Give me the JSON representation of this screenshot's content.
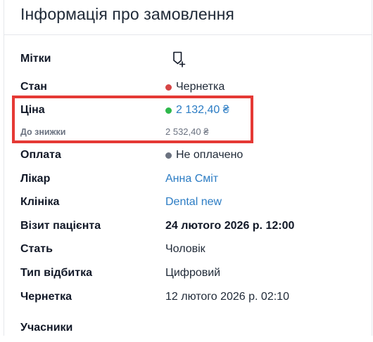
{
  "header": {
    "title": "Інформація про замовлення"
  },
  "rows": {
    "tags": {
      "label": "Мітки",
      "icon": "tag-add-icon"
    },
    "status": {
      "label": "Стан",
      "value": "Чернетка",
      "dot_color": "#d64545"
    },
    "price": {
      "label": "Ціна",
      "value": "2 132,40 ₴",
      "dot_color": "#2eb84b",
      "value_color": "#2b7cc4"
    },
    "price_before_discount": {
      "label": "До знижки",
      "value": "2 532,40 ₴"
    },
    "payment": {
      "label": "Оплата",
      "value": "Не оплачено",
      "dot_color": "#6b7280"
    },
    "doctor": {
      "label": "Лікар",
      "value": "Анна Сміт"
    },
    "clinic": {
      "label": "Клініка",
      "value": "Dental new"
    },
    "patient_visit": {
      "label": "Візит пацієнта",
      "value": "24 лютого 2026 р. 12:00"
    },
    "gender": {
      "label": "Стать",
      "value": "Чоловік"
    },
    "impression_type": {
      "label": "Тип відбитка",
      "value": "Цифровий"
    },
    "draft": {
      "label": "Чернетка",
      "value": "12 лютого 2026 р. 02:10"
    },
    "participants": {
      "label": "Учасники"
    }
  },
  "highlight_color": "#e53935"
}
